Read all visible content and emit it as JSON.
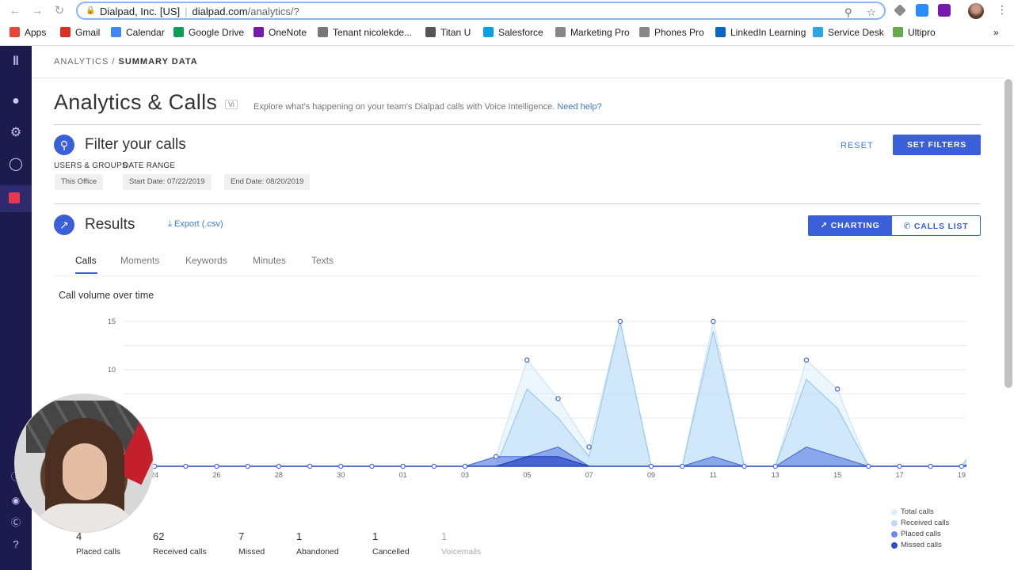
{
  "browser": {
    "site_name": "Dialpad, Inc. [US]",
    "url_host": "dialpad.com",
    "url_path": "/analytics/?",
    "bookmarks": [
      {
        "label": "Apps",
        "color": "#e8453c"
      },
      {
        "label": "Gmail",
        "color": "#d93025"
      },
      {
        "label": "Calendar",
        "color": "#4285f4"
      },
      {
        "label": "Google Drive",
        "color": "#0f9d58"
      },
      {
        "label": "OneNote",
        "color": "#7719aa"
      },
      {
        "label": "Tenant nicolekde...",
        "color": "#777777"
      },
      {
        "label": "Titan U",
        "color": "#555555"
      },
      {
        "label": "Salesforce",
        "color": "#00a1e0"
      },
      {
        "label": "Marketing Pro",
        "color": "#888888"
      },
      {
        "label": "Phones Pro",
        "color": "#888888"
      },
      {
        "label": "LinkedIn Learning",
        "color": "#0a66c2"
      },
      {
        "label": "Service Desk",
        "color": "#2ca5e0"
      },
      {
        "label": "Ultipro",
        "color": "#6aa84f"
      }
    ],
    "more": "»"
  },
  "page": {
    "breadcrumb_root": "ANALYTICS",
    "breadcrumb_sep": " / ",
    "breadcrumb_current": "SUMMARY DATA",
    "title": "Analytics & Calls",
    "vi_badge": "Vi",
    "explore_text": "Explore what's happening on your team's Dialpad calls with Voice Intelligence.",
    "help_link": "Need help?"
  },
  "filters": {
    "heading": "Filter your calls",
    "users_groups_label": "USERS & GROUPS",
    "date_range_label": "DATE RANGE",
    "office_chip": "This Office",
    "start_date": "Start Date:  07/22/2019",
    "end_date": "End Date:  08/20/2019",
    "reset_label": "RESET",
    "set_filters_label": "SET FILTERS"
  },
  "results": {
    "heading": "Results",
    "export_label": "Export (.csv)",
    "charting_label": "CHARTING",
    "calls_list_label": "CALLS LIST",
    "tabs": [
      "Calls",
      "Moments",
      "Keywords",
      "Minutes",
      "Texts"
    ],
    "active_tab": "Calls"
  },
  "chart_data": {
    "type": "area",
    "title": "Call volume over time",
    "y_ticks": [
      10,
      15
    ],
    "ylim": [
      0,
      15
    ],
    "x_tick_labels": [
      "24",
      "26",
      "28",
      "30",
      "01",
      "03",
      "05",
      "07",
      "09",
      "11",
      "13",
      "15",
      "17",
      "19"
    ],
    "x": [
      "07/23",
      "07/24",
      "07/25",
      "07/26",
      "07/27",
      "07/28",
      "07/29",
      "07/30",
      "07/31",
      "08/01",
      "08/02",
      "08/03",
      "08/04",
      "08/05",
      "08/06",
      "08/07",
      "08/08",
      "08/09",
      "08/10",
      "08/11",
      "08/12",
      "08/13",
      "08/14",
      "08/15",
      "08/16",
      "08/17",
      "08/18",
      "08/19",
      "08/20"
    ],
    "series": [
      {
        "name": "Total calls",
        "color": "#dceefb",
        "values": [
          0,
          0,
          0,
          0,
          0,
          0,
          0,
          0,
          0,
          0,
          0,
          0,
          1,
          11,
          7,
          2,
          15,
          0,
          0,
          15,
          0,
          0,
          11,
          8,
          0,
          0,
          0,
          0,
          5
        ]
      },
      {
        "name": "Received calls",
        "color": "#b9dcf6",
        "values": [
          0,
          0,
          0,
          0,
          0,
          0,
          0,
          0,
          0,
          0,
          0,
          0,
          0,
          8,
          5,
          1,
          15,
          0,
          0,
          14,
          0,
          0,
          9,
          6,
          0,
          0,
          0,
          0,
          4
        ]
      },
      {
        "name": "Placed calls",
        "color": "#6d8be6",
        "values": [
          0,
          0,
          0,
          0,
          0,
          0,
          0,
          0,
          0,
          0,
          0,
          0,
          1,
          1,
          2,
          0,
          0,
          0,
          0,
          1,
          0,
          0,
          2,
          1,
          0,
          0,
          0,
          0,
          1
        ]
      },
      {
        "name": "Missed calls",
        "color": "#2f4fc7",
        "values": [
          0,
          0,
          0,
          0,
          0,
          0,
          0,
          0,
          0,
          0,
          0,
          0,
          0,
          1,
          1,
          0,
          0,
          0,
          0,
          0,
          0,
          0,
          0,
          0,
          0,
          0,
          0,
          0,
          0
        ]
      }
    ],
    "legend_position": "bottom-right",
    "grid": true
  },
  "stats": [
    {
      "value": "4",
      "label": "Placed calls"
    },
    {
      "value": "62",
      "label": "Received calls"
    },
    {
      "value": "7",
      "label": "Missed"
    },
    {
      "value": "1",
      "label": "Abandoned"
    },
    {
      "value": "1",
      "label": "Cancelled"
    },
    {
      "value": "1",
      "label": "Voicemails"
    }
  ],
  "colors": {
    "sidebar": "#1d1a4e",
    "accent": "#3a5fd9",
    "link": "#3d7bd6"
  }
}
